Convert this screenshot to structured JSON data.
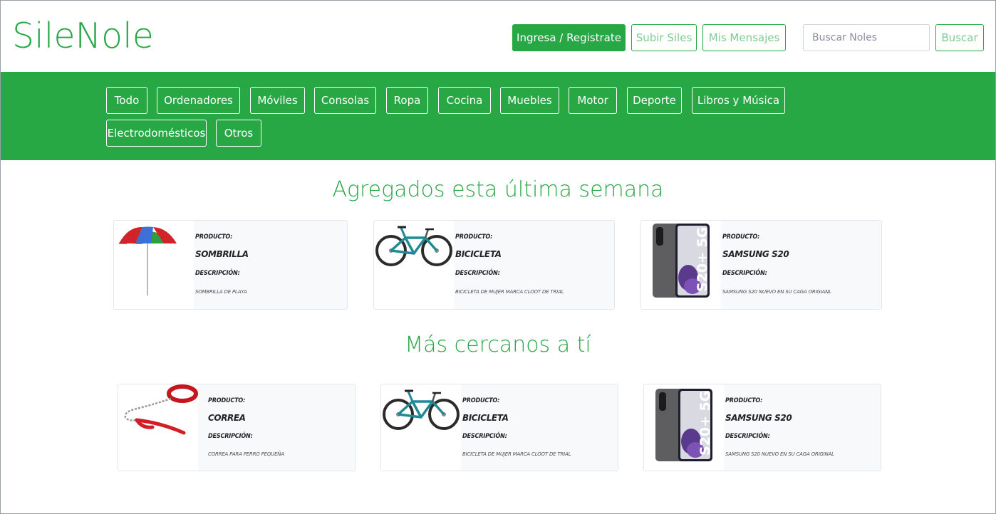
{
  "brand": "SileNole",
  "nav": {
    "login_label": "Ingresa / Registrate",
    "upload_label": "Subir Siles",
    "messages_label": "Mis Mensajes",
    "search_placeholder": "Buscar Noles",
    "search_button": "Buscar"
  },
  "colors": {
    "brand_green": "#28a745",
    "card_bg": "#f8f9fa"
  },
  "categories": [
    "Todo",
    "Ordenadores",
    "Móviles",
    "Consolas",
    "Ropa",
    "Cocina",
    "Muebles",
    "Motor",
    "Deporte",
    "Libros y Música",
    "Electrodomésticos",
    "Otros"
  ],
  "labels": {
    "product": "PRODUCTO:",
    "description": "DESCRIPCIÓN:"
  },
  "sections": [
    {
      "title": "Agregados esta última semana",
      "items": [
        {
          "name": "SOMBRILLA",
          "description": "SOMBRILLA DE PLAYA",
          "image": "umbrella"
        },
        {
          "name": "BICICLETA",
          "description": "BICICLETA DE MUJER MARCA CLOOT DE TRIAL",
          "image": "bicycle"
        },
        {
          "name": "SAMSUNG S20",
          "description": "SAMSUNG S20 NUEVO EN SU CAGA ORIGIANL",
          "image": "phone"
        }
      ]
    },
    {
      "title": "Más cercanos a tí",
      "items": [
        {
          "name": "CORREA",
          "description": "CORREA PARA PERRO PEQUEÑA",
          "image": "leash"
        },
        {
          "name": "BICICLETA",
          "description": "BICICLETA DE MUJER MARCA CLOOT DE TRIAL",
          "image": "bicycle"
        },
        {
          "name": "SAMSUNG S20",
          "description": "SAMSUNG S20 NUEVO EN SU CAGA ORIGINAL",
          "image": "phone"
        }
      ]
    }
  ],
  "phone_badge": "S20+ 5G"
}
